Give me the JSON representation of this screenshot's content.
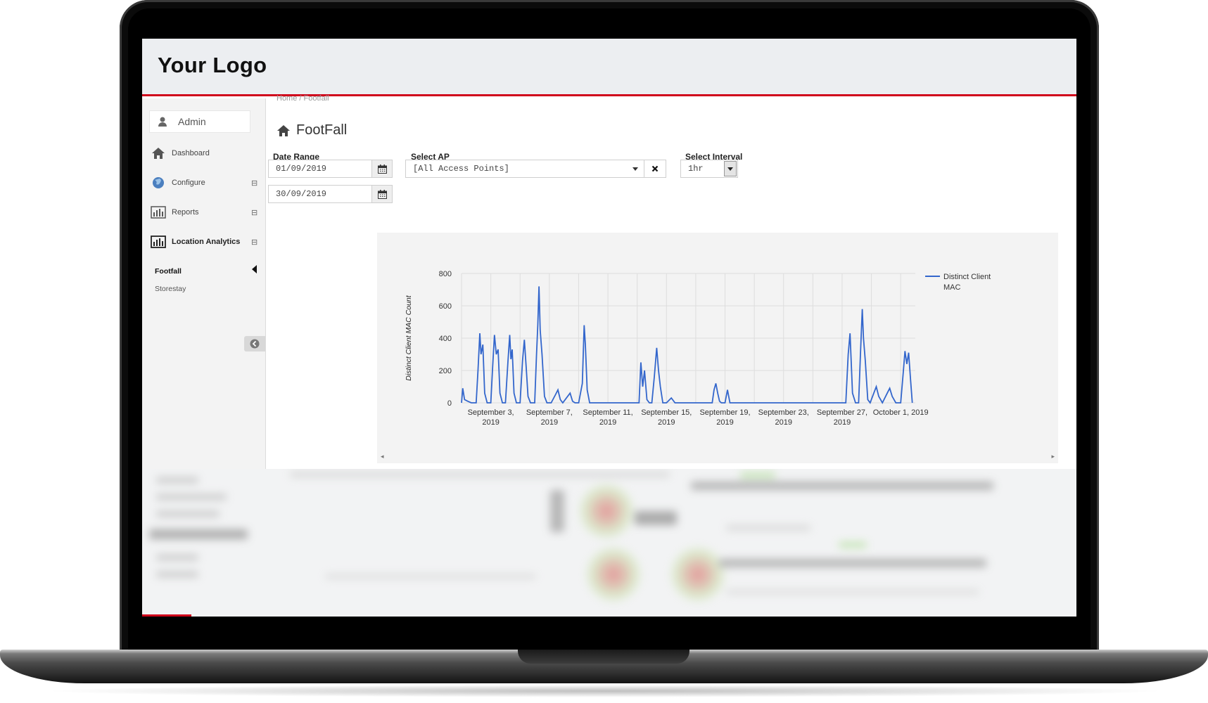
{
  "app": {
    "logo": "Your Logo"
  },
  "sidebar": {
    "user": "Admin",
    "items": [
      {
        "label": "Dashboard",
        "icon": "home-icon"
      },
      {
        "label": "Configure",
        "icon": "globe-icon",
        "toggle": "⊟"
      },
      {
        "label": "Reports",
        "icon": "bar-chart-icon",
        "toggle": "⊟"
      },
      {
        "label": "Location Analytics",
        "icon": "bar-chart-icon",
        "toggle": "⊟"
      }
    ],
    "subitems": [
      {
        "label": "Footfall",
        "active": true
      },
      {
        "label": "Storestay",
        "active": false
      }
    ]
  },
  "content": {
    "breadcrumb": "Home  /  Footfall",
    "title": "FootFall",
    "date_range_label": "Date Range",
    "date_from": "01/09/2019",
    "date_to": "30/09/2019",
    "select_ap_label": "Select AP",
    "select_ap_value": "[All Access Points]",
    "select_interval_label": "Select Interval",
    "select_interval_value": "1hr"
  },
  "colors": {
    "accent": "#d0021b",
    "series": "#3366cc"
  },
  "chart_data": {
    "type": "line",
    "ylabel": "Distinct Client MAC Count",
    "ylim": [
      0,
      800
    ],
    "yticks": [
      0,
      200,
      400,
      600,
      800
    ],
    "xlim": [
      "2019-09-01",
      "2019-10-02"
    ],
    "xticks": [
      {
        "date": "2019-09-03",
        "line1": "September 3,",
        "line2": "2019"
      },
      {
        "date": "2019-09-07",
        "line1": "September 7,",
        "line2": "2019"
      },
      {
        "date": "2019-09-11",
        "line1": "September 11,",
        "line2": "2019"
      },
      {
        "date": "2019-09-15",
        "line1": "September 15,",
        "line2": "2019"
      },
      {
        "date": "2019-09-19",
        "line1": "September 19,",
        "line2": "2019"
      },
      {
        "date": "2019-09-23",
        "line1": "September 23,",
        "line2": "2019"
      },
      {
        "date": "2019-09-27",
        "line1": "September 27,",
        "line2": "2019"
      },
      {
        "date": "2019-10-01",
        "line1": "October 1, 2019",
        "line2": ""
      }
    ],
    "grid": true,
    "legend": {
      "placement": "top-right",
      "line1": "Distinct Client",
      "line2": "MAC"
    },
    "series": [
      {
        "name": "Distinct Client MAC",
        "points": [
          [
            "2019-09-01 00:00",
            0
          ],
          [
            "2019-09-01 02:00",
            90
          ],
          [
            "2019-09-01 05:00",
            20
          ],
          [
            "2019-09-01 10:00",
            10
          ],
          [
            "2019-09-01 16:00",
            0
          ],
          [
            "2019-09-02 00:00",
            0
          ],
          [
            "2019-09-02 03:00",
            200
          ],
          [
            "2019-09-02 06:00",
            430
          ],
          [
            "2019-09-02 08:00",
            300
          ],
          [
            "2019-09-02 11:00",
            360
          ],
          [
            "2019-09-02 14:00",
            60
          ],
          [
            "2019-09-02 18:00",
            0
          ],
          [
            "2019-09-03 00:00",
            0
          ],
          [
            "2019-09-03 03:00",
            220
          ],
          [
            "2019-09-03 06:00",
            420
          ],
          [
            "2019-09-03 09:00",
            300
          ],
          [
            "2019-09-03 12:00",
            330
          ],
          [
            "2019-09-03 15:00",
            60
          ],
          [
            "2019-09-03 19:00",
            0
          ],
          [
            "2019-09-04 00:00",
            0
          ],
          [
            "2019-09-04 04:00",
            250
          ],
          [
            "2019-09-04 07:00",
            420
          ],
          [
            "2019-09-04 09:00",
            270
          ],
          [
            "2019-09-04 11:00",
            330
          ],
          [
            "2019-09-04 14:00",
            60
          ],
          [
            "2019-09-04 18:00",
            0
          ],
          [
            "2019-09-05 00:00",
            0
          ],
          [
            "2019-09-05 04:00",
            260
          ],
          [
            "2019-09-05 07:00",
            390
          ],
          [
            "2019-09-05 10:00",
            220
          ],
          [
            "2019-09-05 13:00",
            40
          ],
          [
            "2019-09-05 17:00",
            0
          ],
          [
            "2019-09-06 00:00",
            0
          ],
          [
            "2019-09-06 03:00",
            300
          ],
          [
            "2019-09-06 05:00",
            480
          ],
          [
            "2019-09-06 07:00",
            720
          ],
          [
            "2019-09-06 09:00",
            450
          ],
          [
            "2019-09-06 12:00",
            300
          ],
          [
            "2019-09-06 16:00",
            40
          ],
          [
            "2019-09-06 20:00",
            0
          ],
          [
            "2019-09-07 03:00",
            0
          ],
          [
            "2019-09-07 10:00",
            50
          ],
          [
            "2019-09-07 14:00",
            80
          ],
          [
            "2019-09-07 18:00",
            20
          ],
          [
            "2019-09-07 22:00",
            0
          ],
          [
            "2019-09-08 06:00",
            40
          ],
          [
            "2019-09-08 10:00",
            60
          ],
          [
            "2019-09-08 14:00",
            10
          ],
          [
            "2019-09-08 18:00",
            0
          ],
          [
            "2019-09-09 00:00",
            0
          ],
          [
            "2019-09-09 06:00",
            120
          ],
          [
            "2019-09-09 09:00",
            480
          ],
          [
            "2019-09-09 11:00",
            360
          ],
          [
            "2019-09-09 14:00",
            80
          ],
          [
            "2019-09-09 18:00",
            0
          ],
          [
            "2019-09-10 00:00",
            0
          ],
          [
            "2019-09-11 00:00",
            0
          ],
          [
            "2019-09-12 00:00",
            0
          ],
          [
            "2019-09-13 03:00",
            0
          ],
          [
            "2019-09-13 06:00",
            250
          ],
          [
            "2019-09-13 09:00",
            100
          ],
          [
            "2019-09-13 12:00",
            200
          ],
          [
            "2019-09-13 16:00",
            20
          ],
          [
            "2019-09-13 20:00",
            0
          ],
          [
            "2019-09-14 00:00",
            0
          ],
          [
            "2019-09-14 04:00",
            160
          ],
          [
            "2019-09-14 08:00",
            340
          ],
          [
            "2019-09-14 11:00",
            200
          ],
          [
            "2019-09-14 14:00",
            100
          ],
          [
            "2019-09-14 18:00",
            0
          ],
          [
            "2019-09-15 00:00",
            0
          ],
          [
            "2019-09-15 08:00",
            30
          ],
          [
            "2019-09-15 14:00",
            0
          ],
          [
            "2019-09-16 00:00",
            0
          ],
          [
            "2019-09-17 00:00",
            0
          ],
          [
            "2019-09-18 03:00",
            0
          ],
          [
            "2019-09-18 06:00",
            80
          ],
          [
            "2019-09-18 09:00",
            120
          ],
          [
            "2019-09-18 12:00",
            60
          ],
          [
            "2019-09-18 15:00",
            10
          ],
          [
            "2019-09-18 18:00",
            0
          ],
          [
            "2019-09-19 00:00",
            0
          ],
          [
            "2019-09-19 04:00",
            80
          ],
          [
            "2019-09-19 08:00",
            0
          ],
          [
            "2019-09-20 00:00",
            0
          ],
          [
            "2019-09-22 00:00",
            0
          ],
          [
            "2019-09-24 00:00",
            0
          ],
          [
            "2019-09-26 00:00",
            0
          ],
          [
            "2019-09-27 06:00",
            0
          ],
          [
            "2019-09-27 10:00",
            300
          ],
          [
            "2019-09-27 13:00",
            430
          ],
          [
            "2019-09-27 17:00",
            60
          ],
          [
            "2019-09-27 22:00",
            0
          ],
          [
            "2019-09-28 03:00",
            0
          ],
          [
            "2019-09-28 06:00",
            300
          ],
          [
            "2019-09-28 09:00",
            580
          ],
          [
            "2019-09-28 11:00",
            400
          ],
          [
            "2019-09-28 14:00",
            260
          ],
          [
            "2019-09-28 18:00",
            20
          ],
          [
            "2019-09-28 22:00",
            0
          ],
          [
            "2019-09-29 04:00",
            60
          ],
          [
            "2019-09-29 08:00",
            100
          ],
          [
            "2019-09-29 12:00",
            40
          ],
          [
            "2019-09-29 18:00",
            0
          ],
          [
            "2019-09-30 02:00",
            60
          ],
          [
            "2019-09-30 06:00",
            90
          ],
          [
            "2019-09-30 10:00",
            40
          ],
          [
            "2019-09-30 16:00",
            0
          ],
          [
            "2019-10-01 00:00",
            0
          ],
          [
            "2019-10-01 04:00",
            180
          ],
          [
            "2019-10-01 07:00",
            320
          ],
          [
            "2019-10-01 10:00",
            240
          ],
          [
            "2019-10-01 13:00",
            310
          ],
          [
            "2019-10-01 16:00",
            150
          ],
          [
            "2019-10-01 19:00",
            0
          ]
        ]
      }
    ]
  }
}
